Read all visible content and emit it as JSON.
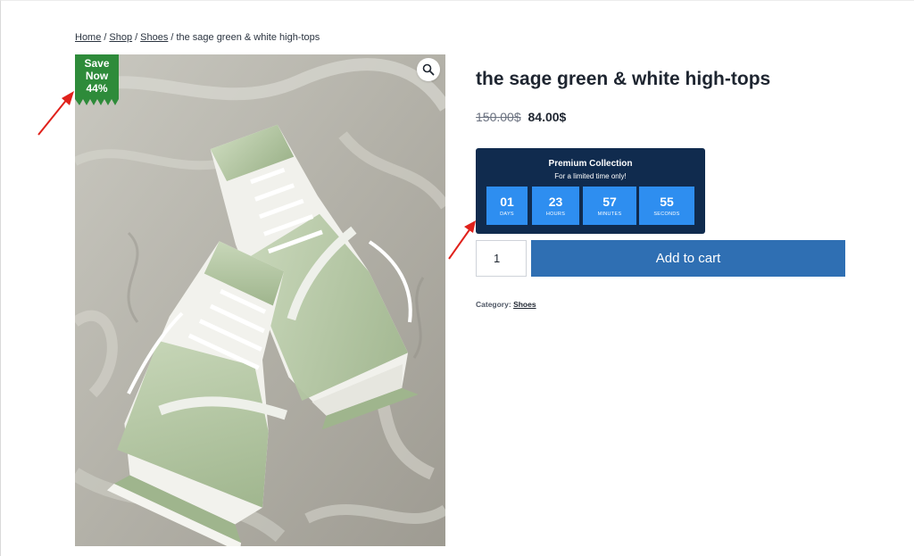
{
  "breadcrumb": {
    "items": [
      "Home",
      "Shop",
      "Shoes"
    ],
    "current": "the sage green & white high-tops",
    "separator": "/"
  },
  "badge": {
    "line1": "Save",
    "line2": "Now",
    "line3": "44%",
    "color": "#2e8b3a"
  },
  "product": {
    "title": "the sage green & white high-tops",
    "old_price": "150.00$",
    "new_price": "84.00$",
    "image_icon": "zoom-icon"
  },
  "countdown": {
    "title": "Premium Collection",
    "subtitle": "For a limited time only!",
    "units": [
      {
        "value": "01",
        "label": "DAYS"
      },
      {
        "value": "23",
        "label": "HOURS"
      },
      {
        "value": "57",
        "label": "MINUTES"
      },
      {
        "value": "55",
        "label": "SECONDS"
      }
    ],
    "bg_color": "#102b4e",
    "box_color": "#2e8ef0"
  },
  "cart": {
    "quantity": "1",
    "button_label": "Add to cart",
    "button_color": "#2f6fb3"
  },
  "meta": {
    "category_label": "Category:",
    "category_value": "Shoes"
  },
  "annotations": {
    "arrow_color": "#e0211b"
  }
}
